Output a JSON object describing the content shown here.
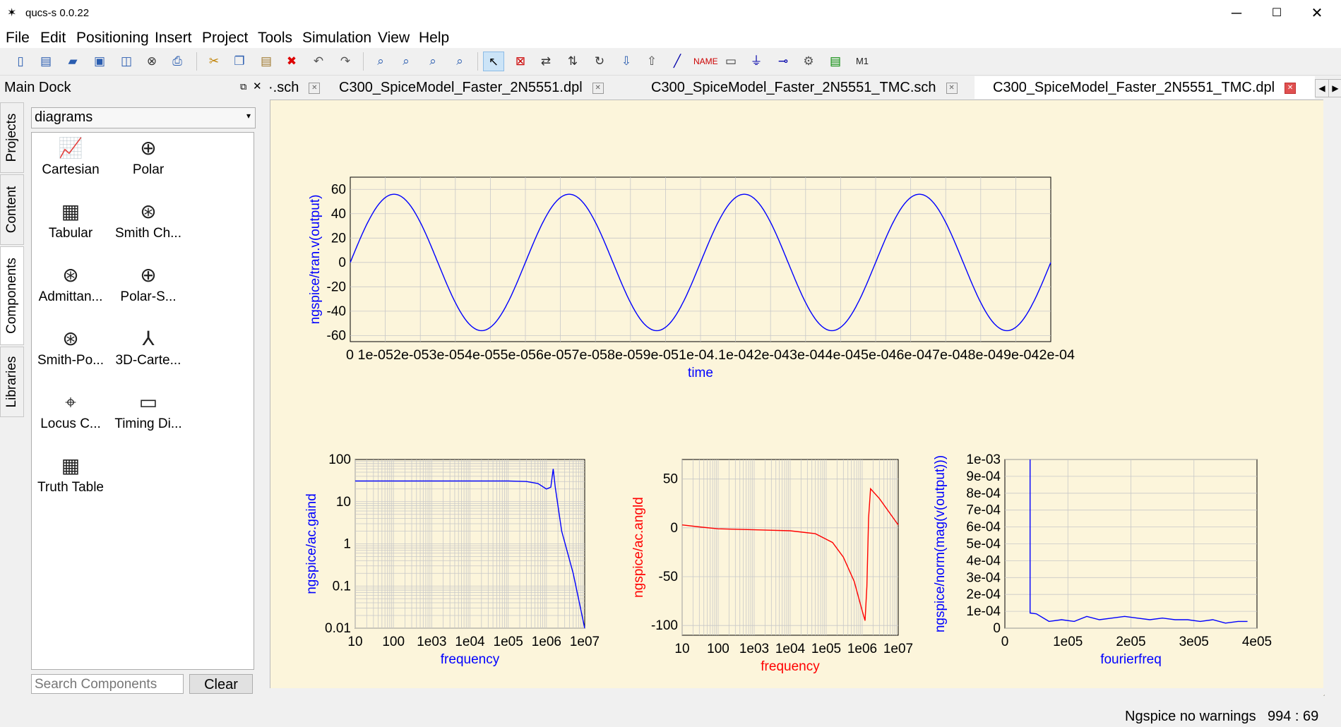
{
  "window": {
    "title": "qucs-s 0.0.22",
    "minimize": "─",
    "maximize": "☐",
    "close": "✕"
  },
  "menu": [
    "File",
    "Edit",
    "Positioning",
    "Insert",
    "Project",
    "Tools",
    "Simulation",
    "View",
    "Help"
  ],
  "dock": {
    "title": "Main Dock",
    "vtabs": [
      "Projects",
      "Content",
      "Components",
      "Libraries"
    ],
    "category": "diagrams",
    "items": [
      {
        "label": "Cartesian",
        "icon": "cartesian-icon"
      },
      {
        "label": "Polar",
        "icon": "polar-icon"
      },
      {
        "label": "Tabular",
        "icon": "tabular-icon"
      },
      {
        "label": "Smith Ch...",
        "icon": "smith-chart-icon"
      },
      {
        "label": "Admittan...",
        "icon": "admittance-icon"
      },
      {
        "label": "Polar-S...",
        "icon": "polar-smith-icon"
      },
      {
        "label": "Smith-Po...",
        "icon": "smith-polar-icon"
      },
      {
        "label": "3D-Carte...",
        "icon": "3d-cartesian-icon"
      },
      {
        "label": "Locus C...",
        "icon": "locus-curve-icon"
      },
      {
        "label": "Timing Di...",
        "icon": "timing-diagram-icon"
      },
      {
        "label": "Truth Table",
        "icon": "truth-table-icon"
      }
    ],
    "search_placeholder": "Search Components",
    "clear": "Clear"
  },
  "tabs": [
    {
      "label": "·.sch"
    },
    {
      "label": "C300_SpiceModel_Faster_2N5551.dpl"
    },
    {
      "label": "C300_SpiceModel_Faster_2N5551_TMC.sch"
    },
    {
      "label": "C300_SpiceModel_Faster_2N5551_TMC.dpl",
      "active": true
    }
  ],
  "status": {
    "message": "Ngspice no warnings",
    "position": "994 : 69"
  },
  "colors": {
    "canvas": "#fcf5db",
    "blue": "#0000ff",
    "red": "#ff0000",
    "grid": "#c8c8c8"
  },
  "chart_data": [
    {
      "type": "line",
      "xlabel": "time",
      "ylabel": "ngspice/tran.v(output)",
      "xlim": [
        0,
        0.0002
      ],
      "ylim": [
        -65,
        70
      ],
      "xticks": [
        "0",
        "1e-05",
        "2e-05",
        "3e-05",
        "4e-05",
        "5e-05",
        "6e-05",
        "7e-05",
        "8e-05",
        "9e-05",
        "1e-04",
        "1.1e-04",
        "1.2e-04",
        "1.3e-04",
        "1.4e-04",
        "1.5e-04",
        "1.6e-04",
        "1.7e-04",
        "1.8e-04",
        "1.9e-04",
        "2e-04"
      ],
      "xticks_rendered": "0 1e-052e-053e-054e-055e-056e-057e-058e-059e-051e-04.1e-042e-043e-044e-045e-046e-047e-048e-049e-042e-04",
      "yticks": [
        "60",
        "40",
        "20",
        "0",
        "-20",
        "-40",
        "-60"
      ],
      "series": [
        {
          "color": "#0000ff",
          "amplitude": 56,
          "frequency_hz": 20000,
          "phase": 0
        }
      ]
    },
    {
      "type": "line",
      "xlabel": "frequency",
      "ylabel": "ngspice/ac.gaind",
      "xscale": "log",
      "yscale": "log",
      "xlim": [
        10,
        10000000
      ],
      "ylim": [
        0.01,
        100
      ],
      "xticks": [
        "10",
        "100",
        "1e03",
        "1e04",
        "1e05",
        "1e06",
        "1e07"
      ],
      "yticks": [
        "100",
        "10",
        "1",
        "0.1",
        "0.01"
      ],
      "series": [
        {
          "color": "#0000ff",
          "x": [
            10,
            100,
            1000,
            10000,
            100000,
            300000,
            600000,
            1000000,
            1300000,
            1500000,
            1700000,
            2500000,
            5000000,
            10000000
          ],
          "y": [
            31,
            31,
            31,
            31,
            31,
            30,
            27,
            20,
            22,
            60,
            22,
            2,
            0.2,
            0.01
          ]
        }
      ]
    },
    {
      "type": "line",
      "xlabel": "frequency",
      "ylabel": "ngspice/ac.angld",
      "xscale": "log",
      "xlim": [
        10,
        10000000
      ],
      "ylim": [
        -110,
        70
      ],
      "xticks": [
        "10",
        "100",
        "1e03",
        "1e04",
        "1e05",
        "1e06",
        "1e07"
      ],
      "yticks": [
        "50",
        "0",
        "-50",
        "-100"
      ],
      "series": [
        {
          "color": "#ff0000",
          "x": [
            10,
            30,
            100,
            1000,
            10000,
            50000,
            150000,
            300000,
            600000,
            1000000,
            1200000,
            1350000,
            1500000,
            1700000,
            3000000,
            10000000
          ],
          "y": [
            3,
            1,
            -1,
            -2,
            -3,
            -6,
            -15,
            -30,
            -55,
            -85,
            -95,
            -60,
            10,
            40,
            30,
            3
          ]
        }
      ]
    },
    {
      "type": "line",
      "xlabel": "fourierfreq",
      "ylabel": "ngspice/norm(mag(v(output)))",
      "xlim": [
        0,
        400000
      ],
      "ylim": [
        0,
        0.001
      ],
      "xticks": [
        "0",
        "1e05",
        "2e05",
        "3e05",
        "4e05"
      ],
      "yticks": [
        "1e-03",
        "9e-04",
        "8e-04",
        "7e-04",
        "6e-04",
        "5e-04",
        "4e-04",
        "3e-04",
        "2e-04",
        "1e-04",
        "0"
      ],
      "series": [
        {
          "color": "#0000ff",
          "x": [
            40000,
            40000,
            50000,
            70000,
            90000,
            110000,
            130000,
            150000,
            170000,
            190000,
            210000,
            230000,
            250000,
            270000,
            290000,
            310000,
            330000,
            350000,
            370000,
            385000
          ],
          "y": [
            0.001,
            9e-05,
            8.5e-05,
            4e-05,
            5e-05,
            4e-05,
            7e-05,
            5e-05,
            6e-05,
            7e-05,
            6e-05,
            5e-05,
            6e-05,
            5e-05,
            5e-05,
            4e-05,
            5e-05,
            3e-05,
            4e-05,
            4e-05
          ]
        }
      ]
    }
  ]
}
